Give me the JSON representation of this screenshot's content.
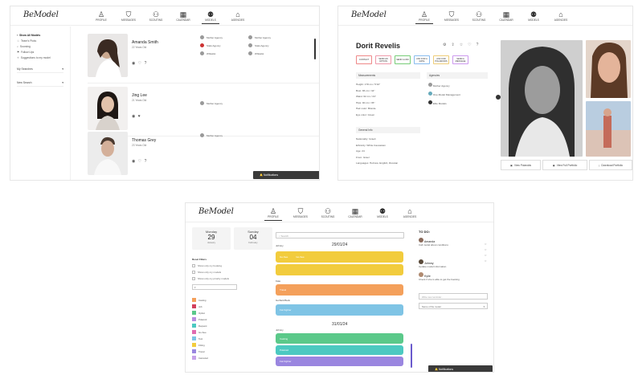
{
  "nav": {
    "logo": "BeModel",
    "items": [
      {
        "label": "PROFILE",
        "icon": "person-icon"
      },
      {
        "label": "MESSAGES",
        "icon": "shield-icon"
      },
      {
        "label": "SCOUTING",
        "icon": "binoculars-icon"
      },
      {
        "label": "CALENDAR",
        "icon": "calendar-icon"
      },
      {
        "label": "MODELS",
        "icon": "models-icon"
      },
      {
        "label": "AGENCIES",
        "icon": "building-icon"
      }
    ]
  },
  "models_view": {
    "sidebar": [
      "Show All Models",
      "Team's Picks",
      "Sourcing",
      "Follow Ups",
      "Suggestions to my model"
    ],
    "filters": [
      "My Searches",
      "New Search"
    ],
    "models": [
      {
        "name": "Amanda Smith",
        "age": "22 Years Old"
      },
      {
        "name": "Jing Lee",
        "age": "21 Years Old"
      },
      {
        "name": "Thomas Grey",
        "age": "23 Years Old"
      }
    ],
    "agency_labels": [
      "Mother Agency",
      "Stats Agency",
      "Whitelist"
    ],
    "notifications": "Notifications"
  },
  "profile_view": {
    "name": "Dorit Revelis",
    "tabs": [
      "CONTACT",
      "SEND AN OPTION",
      "SEND A LINK",
      "ASK FOR A RATE",
      "ASK FOR POLAROIDS",
      "SEND A MESSAGE"
    ],
    "measurements_title": "Measurements",
    "measurements": [
      "Height: 178 cm / 5'10\"",
      "Bust: 86 cm / 34\"",
      "Waist: 62 cm / 24\"",
      "Hips: 90 cm / 35\"",
      "Hair color: Blonde",
      "Eye color: Green"
    ],
    "general_title": "General Info",
    "general": [
      "Nationality: Israeli",
      "Ethnicity: White Caucasian",
      "Age: 24",
      "From: Israel",
      "Languages: Hebrew, English, Russian"
    ],
    "agencies_title": "Agencies",
    "agencies": [
      "Mother Agency",
      "One Model Management",
      "Elite Models"
    ],
    "buttons": [
      "View Polaroids",
      "View Full Portfolio",
      "Download Portfolio"
    ]
  },
  "calendar_view": {
    "date1": {
      "weekday": "Monday",
      "day": "29",
      "month": "January"
    },
    "date2": {
      "weekday": "Sunday",
      "day": "04",
      "month": "February"
    },
    "search_placeholder": "Search...",
    "filters_title": "Reset Filters",
    "filters": [
      "Show only my booking",
      "Show only my models",
      "Show only my priority models"
    ],
    "legend": [
      "Casting",
      "Job",
      "Option",
      "Polaroid",
      "Request",
      "Go-See",
      "Test",
      "Fitting",
      "Travel",
      "Canceled"
    ],
    "day1": "29/01/24",
    "day2": "31/01/24",
    "clients": [
      "Johnny",
      "Kate",
      "Gorfield Buck",
      "Johnny"
    ],
    "events": [
      {
        "label": "Go-See",
        "color": "#f2cc3d"
      },
      {
        "label": "Go-See",
        "color": "#f2cc3d"
      },
      {
        "label": "Travel",
        "color": "#f4a05b"
      },
      {
        "label": "Fat Fighter",
        "color": "#7fc4e5"
      },
      {
        "label": "Casting",
        "color": "#5bc98a"
      },
      {
        "label": "Polaroid",
        "color": "#4cc9c1"
      },
      {
        "label": "Fat Fighter",
        "color": "#9a86e0"
      }
    ],
    "todo_title": "TO DO:",
    "todos": [
      {
        "name": "Amanda",
        "task": "Call model about conditions"
      },
      {
        "name": "Johnny",
        "task": "Update model information"
      },
      {
        "name": "Kylie",
        "task": "Check if she is able to get the booking"
      }
    ],
    "reminder_placeholder": "Write new reminder...",
    "model_select": "Name of the model",
    "notifications": "Notifications"
  }
}
